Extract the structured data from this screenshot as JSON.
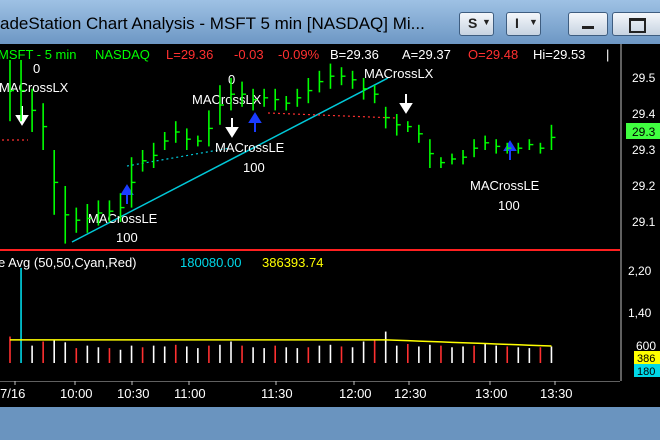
{
  "window": {
    "title": "adeStation Chart Analysis - MSFT 5 min [NASDAQ] Mi...",
    "btn_s": "S",
    "btn_i": "I"
  },
  "colors": {
    "price_bar": "#00ff00",
    "trendline": "#00c8d8",
    "ma_dotted": "#ff3030",
    "volume_avg": "#ffff00",
    "signal_arrow": "#1a3cff",
    "last_price_bg": "#40ff40",
    "volume_cyan": "#00d8e8"
  },
  "header": {
    "symbol": "MSFT - 5 min",
    "exchange": "NASDAQ",
    "last": "L=29.36",
    "change": "-0.03",
    "change_pct": "-0.09%",
    "bid": "B=29.36",
    "ask": "A=29.37",
    "open": "O=29.48",
    "high": "Hi=29.53"
  },
  "volume_header": {
    "label": "e Avg (50,50,Cyan,Red)",
    "value_cyan": "180080.00",
    "value_yellow": "386393.74"
  },
  "price_axis": {
    "ticks": [
      "29.5",
      "29.4",
      "29.3",
      "29.2",
      "29.1"
    ],
    "last_price": "29.3"
  },
  "volume_axis": {
    "ticks": [
      "2,20",
      "1,40",
      "600"
    ],
    "tag_yellow": "386",
    "tag_cyan": "180"
  },
  "time_axis": {
    "labels": [
      "7/16",
      "10:00",
      "10:30",
      "11:00",
      "11:30",
      "12:00",
      "12:30",
      "13:00",
      "13:30"
    ]
  },
  "strategy_labels": [
    {
      "name": "MACrossLX",
      "qty": "0"
    },
    {
      "name": "MACrossLX",
      "qty": "0"
    },
    {
      "name": "MACrossLX",
      "qty": ""
    },
    {
      "name": "MACrossLE",
      "qty": "100"
    },
    {
      "name": "MACrossLE",
      "qty": "100"
    },
    {
      "name": "MACrossLE",
      "qty": "100"
    }
  ],
  "price_bars": [
    {
      "time": "09:35",
      "high": 29.55,
      "low": 29.38
    },
    {
      "time": "09:40",
      "high": 29.55,
      "low": 29.38
    },
    {
      "time": "09:45",
      "high": 29.47,
      "low": 29.35
    },
    {
      "time": "09:50",
      "high": 29.43,
      "low": 29.3
    },
    {
      "time": "09:55",
      "high": 29.3,
      "low": 29.12
    },
    {
      "time": "10:00",
      "high": 29.2,
      "low": 29.04
    },
    {
      "time": "10:05",
      "high": 29.14,
      "low": 29.07
    },
    {
      "time": "10:10",
      "high": 29.15,
      "low": 29.07
    },
    {
      "time": "10:15",
      "high": 29.16,
      "low": 29.09
    },
    {
      "time": "10:20",
      "high": 29.16,
      "low": 29.1
    },
    {
      "time": "10:25",
      "high": 29.18,
      "low": 29.1
    },
    {
      "time": "10:30",
      "high": 29.28,
      "low": 29.14
    },
    {
      "time": "10:35",
      "high": 29.3,
      "low": 29.24
    },
    {
      "time": "10:40",
      "high": 29.32,
      "low": 29.25
    },
    {
      "time": "10:45",
      "high": 29.35,
      "low": 29.3
    },
    {
      "time": "10:50",
      "high": 29.38,
      "low": 29.32
    },
    {
      "time": "10:55",
      "high": 29.36,
      "low": 29.3
    },
    {
      "time": "11:00",
      "high": 29.34,
      "low": 29.31
    },
    {
      "time": "11:05",
      "high": 29.41,
      "low": 29.31
    },
    {
      "time": "11:10",
      "high": 29.48,
      "low": 29.37
    },
    {
      "time": "11:15",
      "high": 29.5,
      "low": 29.41
    },
    {
      "time": "11:20",
      "high": 29.49,
      "low": 29.42
    },
    {
      "time": "11:25",
      "high": 29.47,
      "low": 29.41
    },
    {
      "time": "11:30",
      "high": 29.47,
      "low": 29.42
    },
    {
      "time": "11:35",
      "high": 29.47,
      "low": 29.41
    },
    {
      "time": "11:40",
      "high": 29.45,
      "low": 29.41
    },
    {
      "time": "11:45",
      "high": 29.47,
      "low": 29.42
    },
    {
      "time": "11:50",
      "high": 29.5,
      "low": 29.43
    },
    {
      "time": "11:55",
      "high": 29.52,
      "low": 29.46
    },
    {
      "time": "12:00",
      "high": 29.54,
      "low": 29.47
    },
    {
      "time": "12:05",
      "high": 29.53,
      "low": 29.48
    },
    {
      "time": "12:10",
      "high": 29.52,
      "low": 29.47
    },
    {
      "time": "12:15",
      "high": 29.5,
      "low": 29.44
    },
    {
      "time": "12:20",
      "high": 29.48,
      "low": 29.43
    },
    {
      "time": "12:25",
      "high": 29.42,
      "low": 29.36
    },
    {
      "time": "12:30",
      "high": 29.4,
      "low": 29.34
    },
    {
      "time": "12:35",
      "high": 29.38,
      "low": 29.35
    },
    {
      "time": "12:40",
      "high": 29.37,
      "low": 29.32
    },
    {
      "time": "12:45",
      "high": 29.33,
      "low": 29.25
    },
    {
      "time": "12:50",
      "high": 29.28,
      "low": 29.25
    },
    {
      "time": "12:55",
      "high": 29.29,
      "low": 29.26
    },
    {
      "time": "13:00",
      "high": 29.3,
      "low": 29.26
    },
    {
      "time": "13:05",
      "high": 29.33,
      "low": 29.28
    },
    {
      "time": "13:10",
      "high": 29.34,
      "low": 29.3
    },
    {
      "time": "13:15",
      "high": 29.33,
      "low": 29.29
    },
    {
      "time": "13:20",
      "high": 29.32,
      "low": 29.29
    },
    {
      "time": "13:25",
      "high": 29.32,
      "low": 29.29
    },
    {
      "time": "13:30",
      "high": 29.33,
      "low": 29.3
    },
    {
      "time": "13:35",
      "high": 29.32,
      "low": 29.29
    },
    {
      "time": "13:40",
      "high": 29.37,
      "low": 29.3
    }
  ],
  "volume_bars": [
    640,
    2300,
    420,
    520,
    560,
    500,
    360,
    420,
    380,
    360,
    320,
    420,
    380,
    420,
    400,
    440,
    400,
    360,
    420,
    440,
    520,
    420,
    380,
    360,
    420,
    380,
    360,
    380,
    420,
    440,
    400,
    380,
    520,
    560,
    760,
    420,
    460,
    400,
    440,
    420,
    380,
    400,
    420,
    460,
    420,
    400,
    380,
    360,
    380,
    400
  ],
  "volume_avg": [
    560,
    560,
    560,
    560,
    560,
    560,
    560,
    560,
    560,
    560,
    560,
    560,
    560,
    560,
    560,
    560,
    560,
    560,
    560,
    560,
    560,
    560,
    560,
    560,
    560,
    560,
    560,
    560,
    560,
    560,
    560,
    560,
    560,
    560,
    560,
    550,
    540,
    530,
    520,
    510,
    500,
    490,
    480,
    470,
    460,
    450,
    440,
    430,
    420,
    410
  ]
}
